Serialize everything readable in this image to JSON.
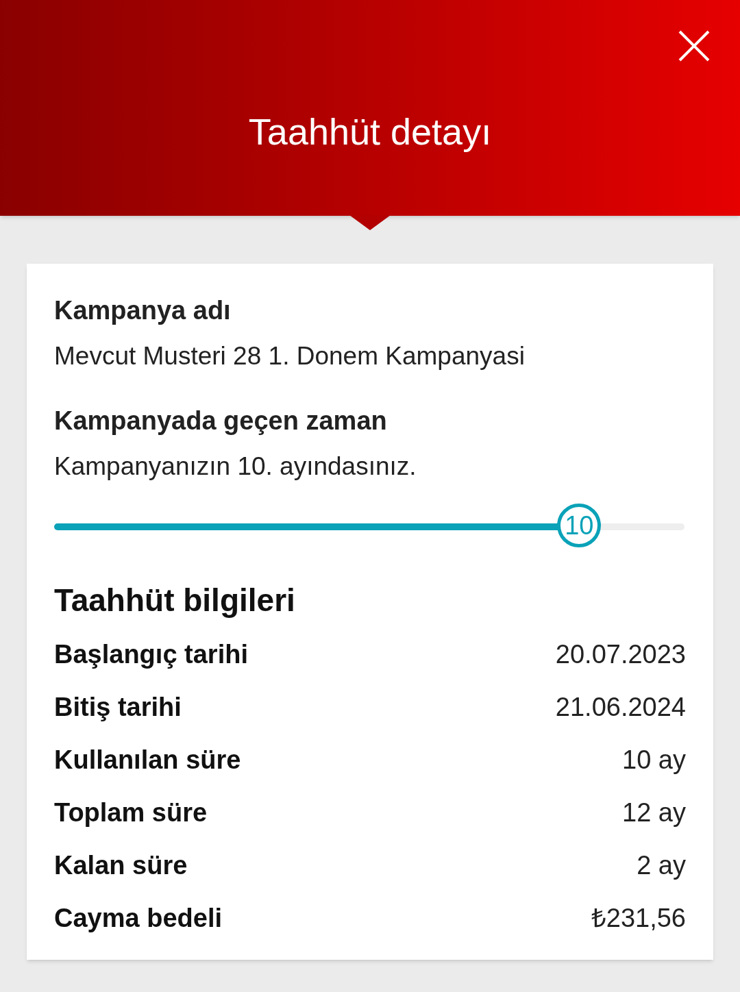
{
  "header": {
    "title": "Taahhüt detayı"
  },
  "campaign": {
    "name_label": "Kampanya adı",
    "name": "Mevcut Musteri 28 1. Donem Kampanyasi",
    "elapsed_label": "Kampanyada geçen zaman",
    "elapsed_text": "Kampanyanızın 10. ayındasınız.",
    "slider": {
      "level": 0.833,
      "thumb_label": "10"
    }
  },
  "commitment": {
    "title": "Taahhüt bilgileri",
    "rows": [
      {
        "label": "Başlangıç tarihi",
        "value": "20.07.2023"
      },
      {
        "label": "Bitiş tarihi",
        "value": "21.06.2024"
      },
      {
        "label": "Kullanılan süre",
        "value": "10 ay"
      },
      {
        "label": "Toplam süre",
        "value": "12 ay"
      },
      {
        "label": "Kalan süre",
        "value": "2 ay"
      },
      {
        "label": "Cayma bedeli",
        "value": "₺231,56"
      }
    ]
  }
}
